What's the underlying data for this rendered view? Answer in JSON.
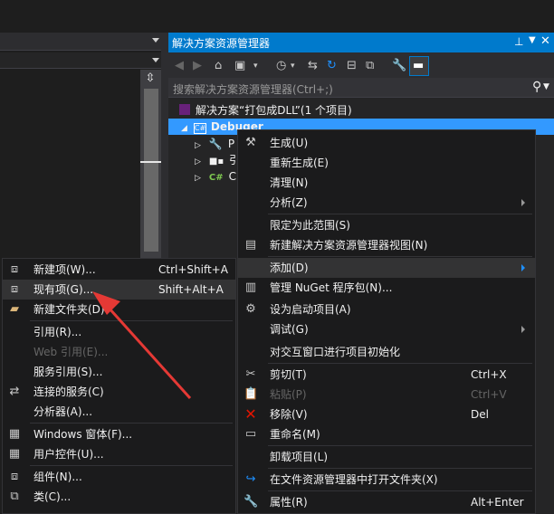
{
  "solution_explorer": {
    "title": "解决方案资源管理器",
    "search_placeholder": "搜索解决方案资源管理器(Ctrl+;)",
    "tree": {
      "solution_label": "解决方案“打包成DLL”(1 个项目)",
      "project_label": "Debuger",
      "child_p": "P",
      "child_2": "引",
      "child_3": "C"
    }
  },
  "context_menu": {
    "items": [
      {
        "label": "生成(U)",
        "shortcut": "",
        "icon": "build-icon"
      },
      {
        "label": "重新生成(E)",
        "shortcut": "",
        "icon": ""
      },
      {
        "label": "清理(N)",
        "shortcut": "",
        "icon": ""
      },
      {
        "label": "分析(Z)",
        "shortcut": "",
        "icon": ""
      },
      {
        "label": "限定为此范围(S)",
        "shortcut": "",
        "icon": ""
      },
      {
        "label": "新建解决方案资源管理器视图(N)",
        "shortcut": "",
        "icon": "new-view-icon"
      },
      {
        "label": "添加(D)",
        "shortcut": "",
        "icon": ""
      },
      {
        "label": "管理 NuGet 程序包(N)...",
        "shortcut": "",
        "icon": "nuget-icon"
      },
      {
        "label": "设为启动项目(A)",
        "shortcut": "",
        "icon": "gear-icon"
      },
      {
        "label": "调试(G)",
        "shortcut": "",
        "icon": ""
      },
      {
        "label": "对交互窗口进行项目初始化",
        "shortcut": "",
        "icon": ""
      },
      {
        "label": "剪切(T)",
        "shortcut": "Ctrl+X",
        "icon": "scissors-icon"
      },
      {
        "label": "粘贴(P)",
        "shortcut": "Ctrl+V",
        "icon": "paste-icon"
      },
      {
        "label": "移除(V)",
        "shortcut": "Del",
        "icon": "delete-icon"
      },
      {
        "label": "重命名(M)",
        "shortcut": "",
        "icon": "rename-icon"
      },
      {
        "label": "卸载项目(L)",
        "shortcut": "",
        "icon": ""
      },
      {
        "label": "在文件资源管理器中打开文件夹(X)",
        "shortcut": "",
        "icon": "open-folder-icon"
      },
      {
        "label": "属性(R)",
        "shortcut": "Alt+Enter",
        "icon": "wrench-icon"
      }
    ]
  },
  "add_submenu": {
    "items": [
      {
        "label": "新建项(W)...",
        "shortcut": "Ctrl+Shift+A"
      },
      {
        "label": "现有项(G)...",
        "shortcut": "Shift+Alt+A"
      },
      {
        "label": "新建文件夹(D)",
        "shortcut": ""
      },
      {
        "label": "引用(R)...",
        "shortcut": ""
      },
      {
        "label": "Web 引用(E)...",
        "shortcut": ""
      },
      {
        "label": "服务引用(S)...",
        "shortcut": ""
      },
      {
        "label": "连接的服务(C)",
        "shortcut": ""
      },
      {
        "label": "分析器(A)...",
        "shortcut": ""
      },
      {
        "label": "Windows 窗体(F)...",
        "shortcut": ""
      },
      {
        "label": "用户控件(U)...",
        "shortcut": ""
      },
      {
        "label": "组件(N)...",
        "shortcut": ""
      },
      {
        "label": "类(C)...",
        "shortcut": ""
      }
    ]
  },
  "colors": {
    "accent": "#007acc",
    "selection": "#3399ff",
    "menu_bg": "#1b1b1c",
    "highlight": "#333334",
    "arrow_red": "#e53935"
  }
}
